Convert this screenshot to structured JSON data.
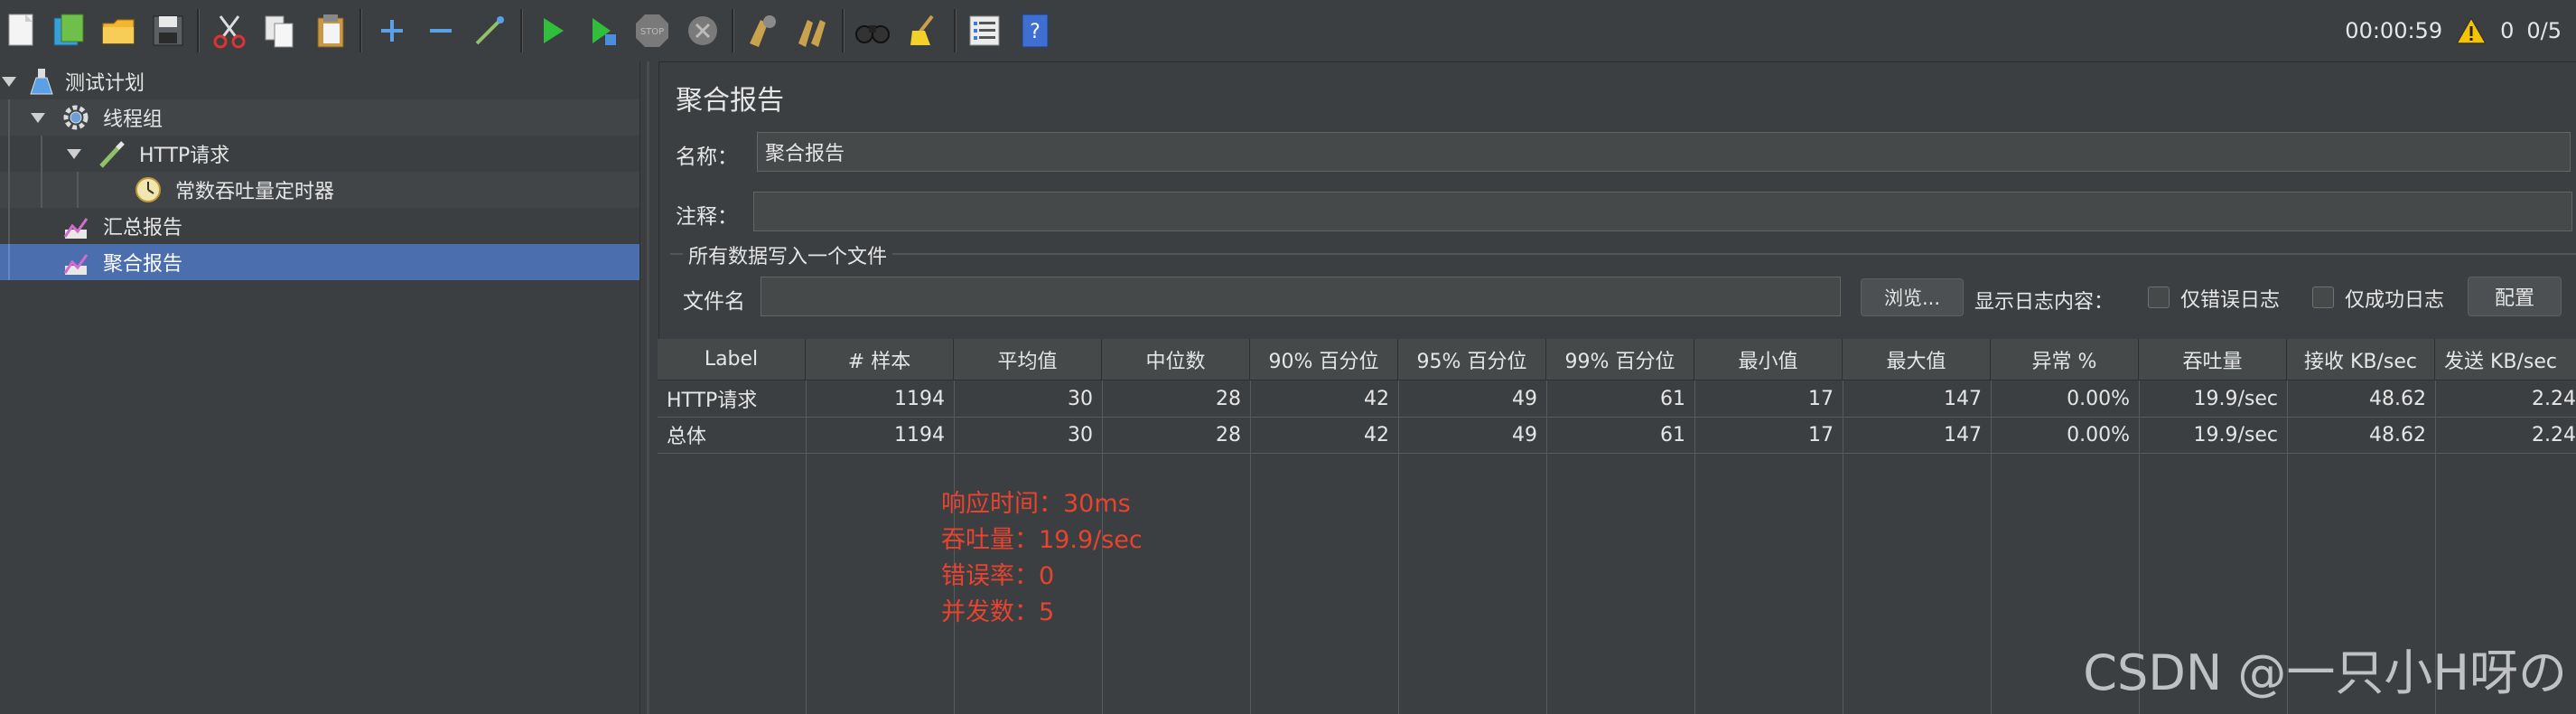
{
  "toolbar": {
    "icons": [
      "new-icon",
      "templates-icon",
      "open-icon",
      "save-icon",
      "cut-icon",
      "copy-icon",
      "paste-icon",
      "expand-icon",
      "collapse-icon",
      "toggle-icon",
      "start-icon",
      "start-no-pause-icon",
      "stop-icon",
      "shutdown-icon",
      "clear-icon",
      "clear-all-icon",
      "search-icon",
      "reset-search-icon",
      "function-helper-icon",
      "help-icon"
    ],
    "stop_label": "STOP",
    "timer": "00:00:59",
    "warnings": "0",
    "threads": "0/5",
    "colors": {
      "start": "#2fbf3a",
      "warning": "#f5c400"
    }
  },
  "tree": {
    "items": [
      {
        "label": "测试计划",
        "icon": "test-plan-flask-icon"
      },
      {
        "label": "线程组",
        "icon": "thread-group-gear-icon"
      },
      {
        "label": "HTTP请求",
        "icon": "http-sampler-pen-icon"
      },
      {
        "label": "常数吞吐量定时器",
        "icon": "timer-clock-icon"
      },
      {
        "label": "汇总报告",
        "icon": "summary-report-chart-icon"
      },
      {
        "label": "聚合报告",
        "icon": "aggregate-report-chart-icon"
      }
    ]
  },
  "panel": {
    "title": "聚合报告",
    "name_label": "名称：",
    "name_value": "聚合报告",
    "comment_label": "注释：",
    "comment_value": "",
    "fieldset_title": "所有数据写入一个文件",
    "filename_label": "文件名",
    "filename_value": "",
    "browse_button": "浏览...",
    "log_content_label": "显示日志内容：",
    "errors_only_label": "仅错误日志",
    "success_only_label": "仅成功日志",
    "config_button": "配置"
  },
  "table": {
    "columns": [
      "Label",
      "# 样本",
      "平均值",
      "中位数",
      "90% 百分位",
      "95% 百分位",
      "99% 百分位",
      "最小值",
      "最大值",
      "异常 %",
      "吞吐量",
      "接收 KB/sec",
      "发送 KB/sec"
    ],
    "rows": [
      [
        "HTTP请求",
        "1194",
        "30",
        "28",
        "42",
        "49",
        "61",
        "17",
        "147",
        "0.00%",
        "19.9/sec",
        "48.62",
        "2.24"
      ],
      [
        "总体",
        "1194",
        "30",
        "28",
        "42",
        "49",
        "61",
        "17",
        "147",
        "0.00%",
        "19.9/sec",
        "48.62",
        "2.24"
      ]
    ]
  },
  "annotation": {
    "lines": [
      "响应时间：30ms",
      "吞吐量：19.9/sec",
      "错误率：0",
      "并发数：5"
    ],
    "color": "#e8432f"
  },
  "watermark": "CSDN @一只小H呀の"
}
